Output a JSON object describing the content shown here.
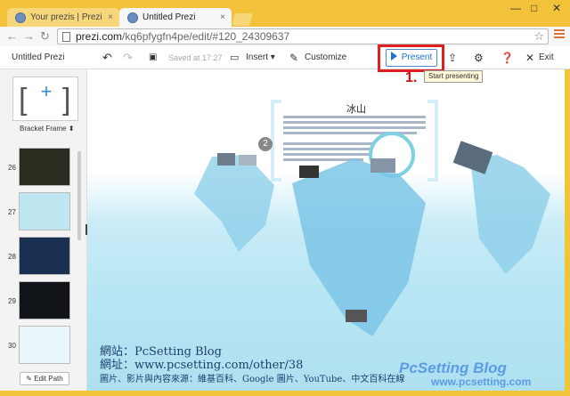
{
  "browser": {
    "tabs": [
      {
        "label": "Your prezis | Prezi",
        "close": "×"
      },
      {
        "label": "Untitled Prezi",
        "close": "×"
      }
    ],
    "window_controls": {
      "minimize": "—",
      "maximize": "□",
      "close": "✕"
    },
    "url_host": "prezi.com",
    "url_path": "/kq6pfygfn4pe/edit/#120_24309637"
  },
  "toolbar": {
    "title": "Untitled Prezi",
    "saved": "Saved at 17:27",
    "insert": "Insert",
    "customize": "Customize",
    "present": "Present",
    "exit": "Exit",
    "tooltip": "Start presenting"
  },
  "annotation": {
    "step": "1."
  },
  "sidebar": {
    "frame_label": "Bracket Frame",
    "thumbs": [
      {
        "num": "26",
        "color": "#2b2b20"
      },
      {
        "num": "27",
        "color": "#bfe7f2"
      },
      {
        "num": "28",
        "color": "#1a3050"
      },
      {
        "num": "29",
        "color": "#111418"
      },
      {
        "num": "30",
        "color": "#e9f6fb"
      }
    ],
    "edit_path": "Edit Path"
  },
  "canvas": {
    "title": "冰山",
    "frame_number": "2"
  },
  "watermark": {
    "line1": "網站：PcSetting Blog",
    "line2": "網址：www.pcsetting.com/other/38",
    "line3": "圖片、影片與內容來源：維基百科、Google 圖片、YouTube、中文百科在線",
    "logo_title": "PcSetting Blog",
    "logo_url": "www.pcsetting.com"
  },
  "colors": {
    "accent": "#1d72d0",
    "highlight": "#e02020",
    "chrome": "#f2c33a"
  }
}
